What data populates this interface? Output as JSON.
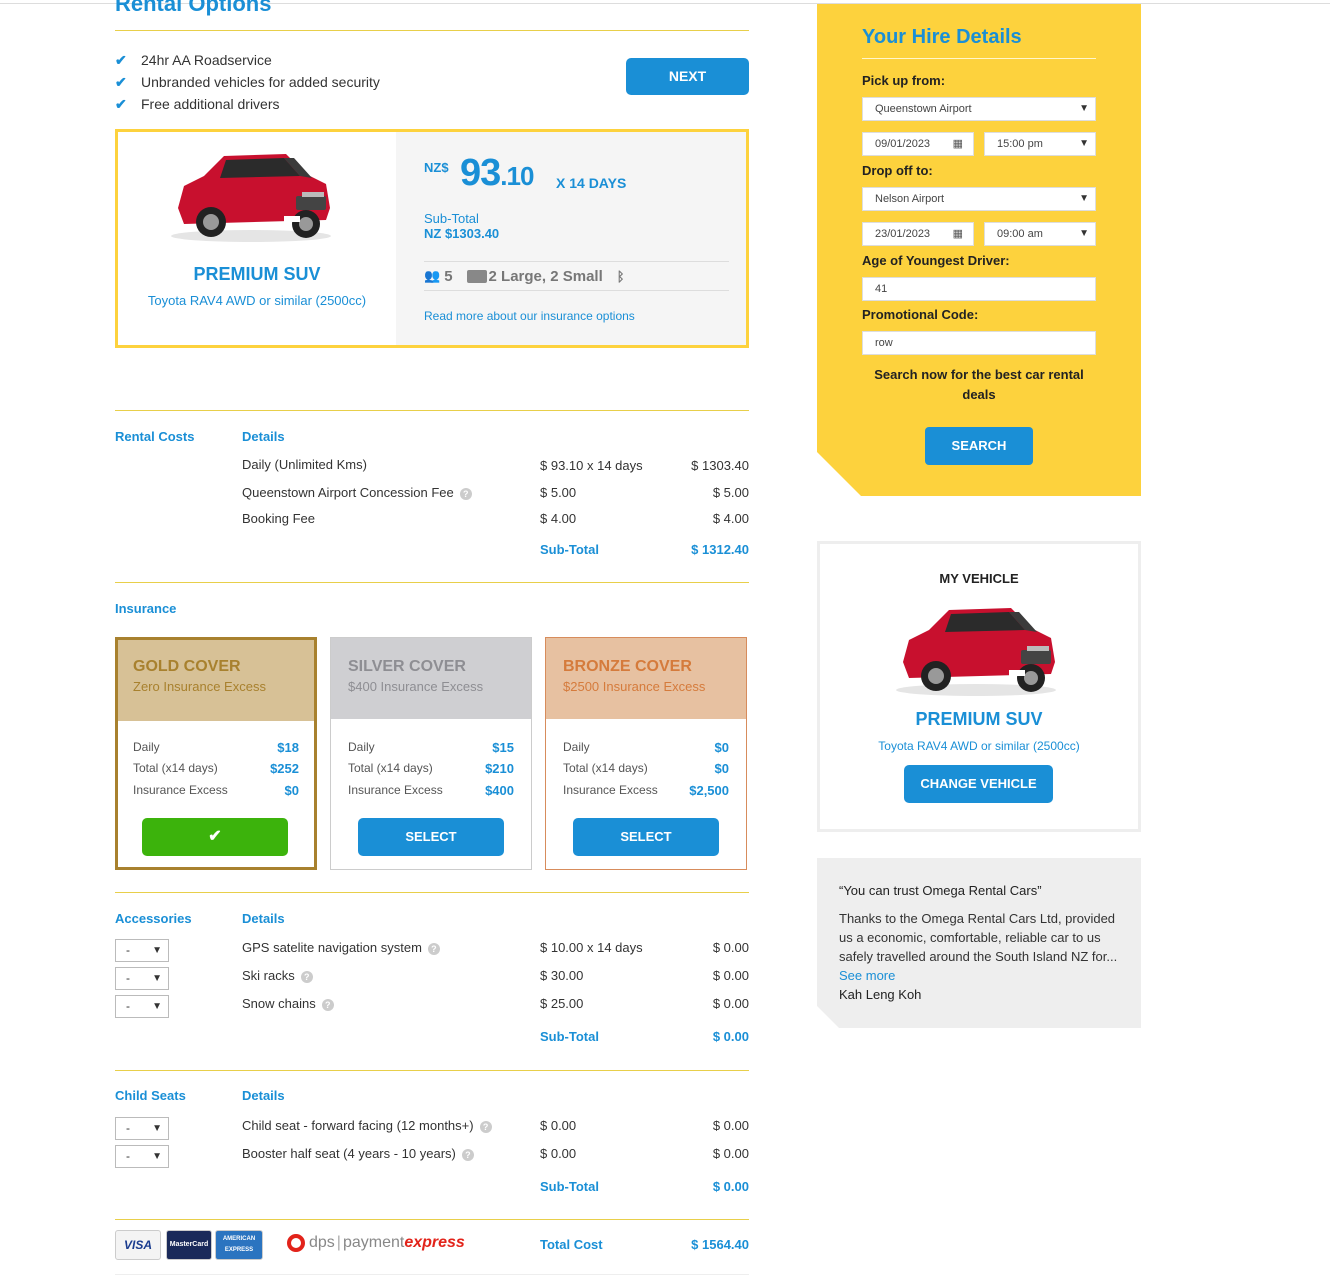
{
  "page": {
    "title": "Rental Options",
    "features": [
      "24hr AA Roadservice",
      "Unbranded vehicles for added security",
      "Free additional drivers"
    ],
    "next_label": "NEXT"
  },
  "vehicle": {
    "name": "PREMIUM SUV",
    "model": "Toyota RAV4 AWD or similar (2500cc)",
    "currency": "NZ$",
    "price_int": "93",
    "price_dec": ".10",
    "days": "X 14 DAYS",
    "subtotal_label": "Sub-Total",
    "subtotal_value": "NZ $1303.40",
    "passengers": "5",
    "luggage": "2 Large, 2 Small",
    "insurance_link": "Read more about our insurance options",
    "car_color": "#c8102e"
  },
  "rental_costs": {
    "label": "Rental Costs",
    "details_label": "Details",
    "rows": [
      {
        "name": "Daily (Unlimited Kms)",
        "rate": "$ 93.10 x 14 days",
        "total": "$ 1303.40"
      },
      {
        "name": "Queenstown Airport Concession Fee",
        "rate": "$ 5.00",
        "total": "$ 5.00"
      },
      {
        "name": "Booking Fee",
        "rate": "$ 4.00",
        "total": "$ 4.00"
      }
    ],
    "subtotal_label": "Sub-Total",
    "subtotal_value": "$ 1312.40"
  },
  "insurance": {
    "label": "Insurance",
    "covers": [
      {
        "title": "GOLD COVER",
        "sub": "Zero Insurance Excess",
        "daily": "$18",
        "total": "$252",
        "excess": "$0",
        "button": ""
      },
      {
        "title": "SILVER COVER",
        "sub": "$400 Insurance Excess",
        "daily": "$15",
        "total": "$210",
        "excess": "$400",
        "button": "SELECT"
      },
      {
        "title": "BRONZE COVER",
        "sub": "$2500 Insurance Excess",
        "daily": "$0",
        "total": "$0",
        "excess": "$2,500",
        "button": "SELECT"
      }
    ],
    "row_labels": {
      "daily": "Daily",
      "total": "Total (x14 days)",
      "excess": "Insurance Excess"
    }
  },
  "accessories": {
    "label": "Accessories",
    "details_label": "Details",
    "rows": [
      {
        "qty": "-",
        "name": "GPS satelite navigation system",
        "rate": "$ 10.00 x 14 days",
        "total": "$ 0.00"
      },
      {
        "qty": "-",
        "name": "Ski racks",
        "rate": "$ 30.00",
        "total": "$ 0.00"
      },
      {
        "qty": "-",
        "name": "Snow chains",
        "rate": "$ 25.00",
        "total": "$ 0.00"
      }
    ],
    "subtotal_label": "Sub-Total",
    "subtotal_value": "$ 0.00"
  },
  "child_seats": {
    "label": "Child Seats",
    "details_label": "Details",
    "rows": [
      {
        "qty": "-",
        "name": "Child seat - forward facing (12 months+)",
        "rate": "$ 0.00",
        "total": "$ 0.00"
      },
      {
        "qty": "-",
        "name": "Booster half seat (4 years - 10 years)",
        "rate": "$ 0.00",
        "total": "$ 0.00"
      }
    ],
    "subtotal_label": "Sub-Total",
    "subtotal_value": "$ 0.00"
  },
  "footer": {
    "total_label": "Total Cost",
    "total_value": "$ 1564.40",
    "logos": [
      "VISA",
      "MasterCard",
      "AMERICAN EXPRESS",
      "dps",
      "payment",
      "express"
    ]
  },
  "hire": {
    "title": "Your Hire Details",
    "pickup_label": "Pick up from:",
    "pickup_location": "Queenstown Airport",
    "pickup_date": "09/01/2023",
    "pickup_time": "15:00 pm",
    "dropoff_label": "Drop off to:",
    "dropoff_location": "Nelson Airport",
    "dropoff_date": "23/01/2023",
    "dropoff_time": "09:00 am",
    "age_label": "Age of Youngest Driver:",
    "age_value": "41",
    "promo_label": "Promotional Code:",
    "promo_value": "row",
    "note": "Search now for the best car rental deals",
    "search_label": "SEARCH"
  },
  "my_vehicle": {
    "title": "MY VEHICLE",
    "name": "PREMIUM SUV",
    "model": "Toyota RAV4 AWD or similar (2500cc)",
    "change_label": "CHANGE VEHICLE"
  },
  "testimonial": {
    "quote": "“You can trust Omega Rental Cars”",
    "body": "Thanks to the Omega Rental Cars Ltd, provided us a economic, comfortable, reliable car to us safely travelled around the South Island NZ for...",
    "see_more": "See more",
    "author": "Kah Leng Koh"
  },
  "colors": {
    "accent": "#1a8fd6",
    "yellow": "#fdd23d",
    "green": "#3cb30c",
    "gold": "#a8812e",
    "bronze": "#d57b3c"
  }
}
